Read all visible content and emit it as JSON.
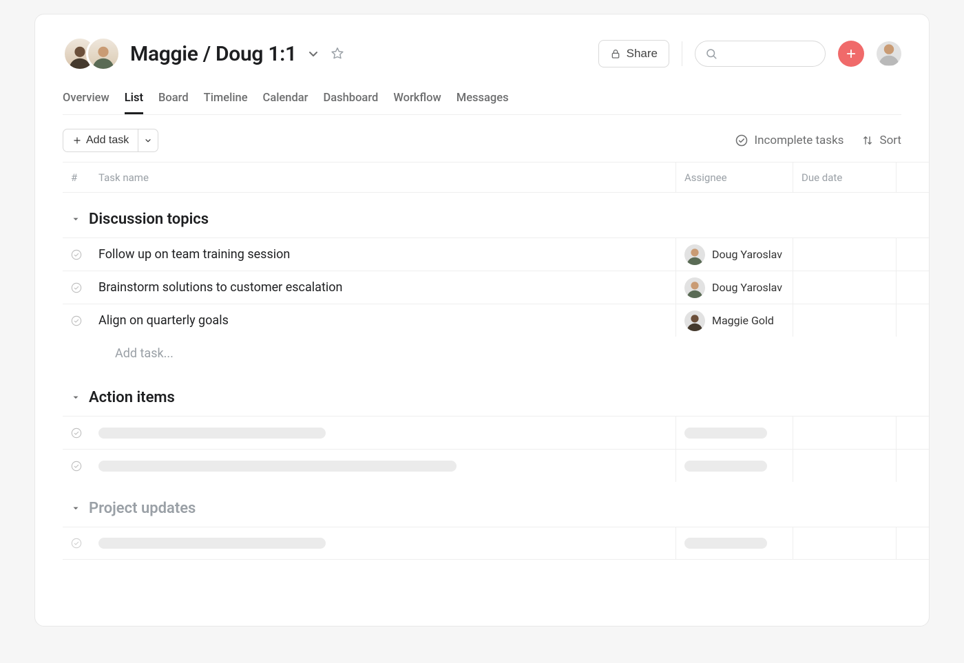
{
  "project": {
    "title": "Maggie / Doug 1:1",
    "members": [
      "Maggie Gold",
      "Doug Yaroslav"
    ]
  },
  "header": {
    "share_label": "Share",
    "search_placeholder": ""
  },
  "tabs": [
    "Overview",
    "List",
    "Board",
    "Timeline",
    "Calendar",
    "Dashboard",
    "Workflow",
    "Messages"
  ],
  "active_tab": "List",
  "toolbar": {
    "add_task_label": "Add task",
    "filter_label": "Incomplete tasks",
    "sort_label": "Sort"
  },
  "columns": {
    "number": "#",
    "task_name": "Task name",
    "assignee": "Assignee",
    "due_date": "Due date"
  },
  "sections": [
    {
      "title": "Discussion topics",
      "muted": false,
      "tasks": [
        {
          "name": "Follow up on team training session",
          "assignee": "Doug Yaroslav",
          "assignee_key": "doug"
        },
        {
          "name": "Brainstorm solutions to customer escalation",
          "assignee": "Doug Yaroslav",
          "assignee_key": "doug"
        },
        {
          "name": "Align on quarterly goals",
          "assignee": "Maggie Gold",
          "assignee_key": "maggie"
        }
      ],
      "add_task_placeholder": "Add task..."
    },
    {
      "title": "Action items",
      "muted": false,
      "tasks": [
        {
          "placeholder": true,
          "name_width": 330,
          "assignee_width": 120
        },
        {
          "placeholder": true,
          "name_width": 520,
          "assignee_width": 120
        }
      ]
    },
    {
      "title": "Project updates",
      "muted": true,
      "tasks": [
        {
          "placeholder": true,
          "name_width": 330,
          "assignee_width": 120,
          "faded": true
        }
      ]
    }
  ]
}
